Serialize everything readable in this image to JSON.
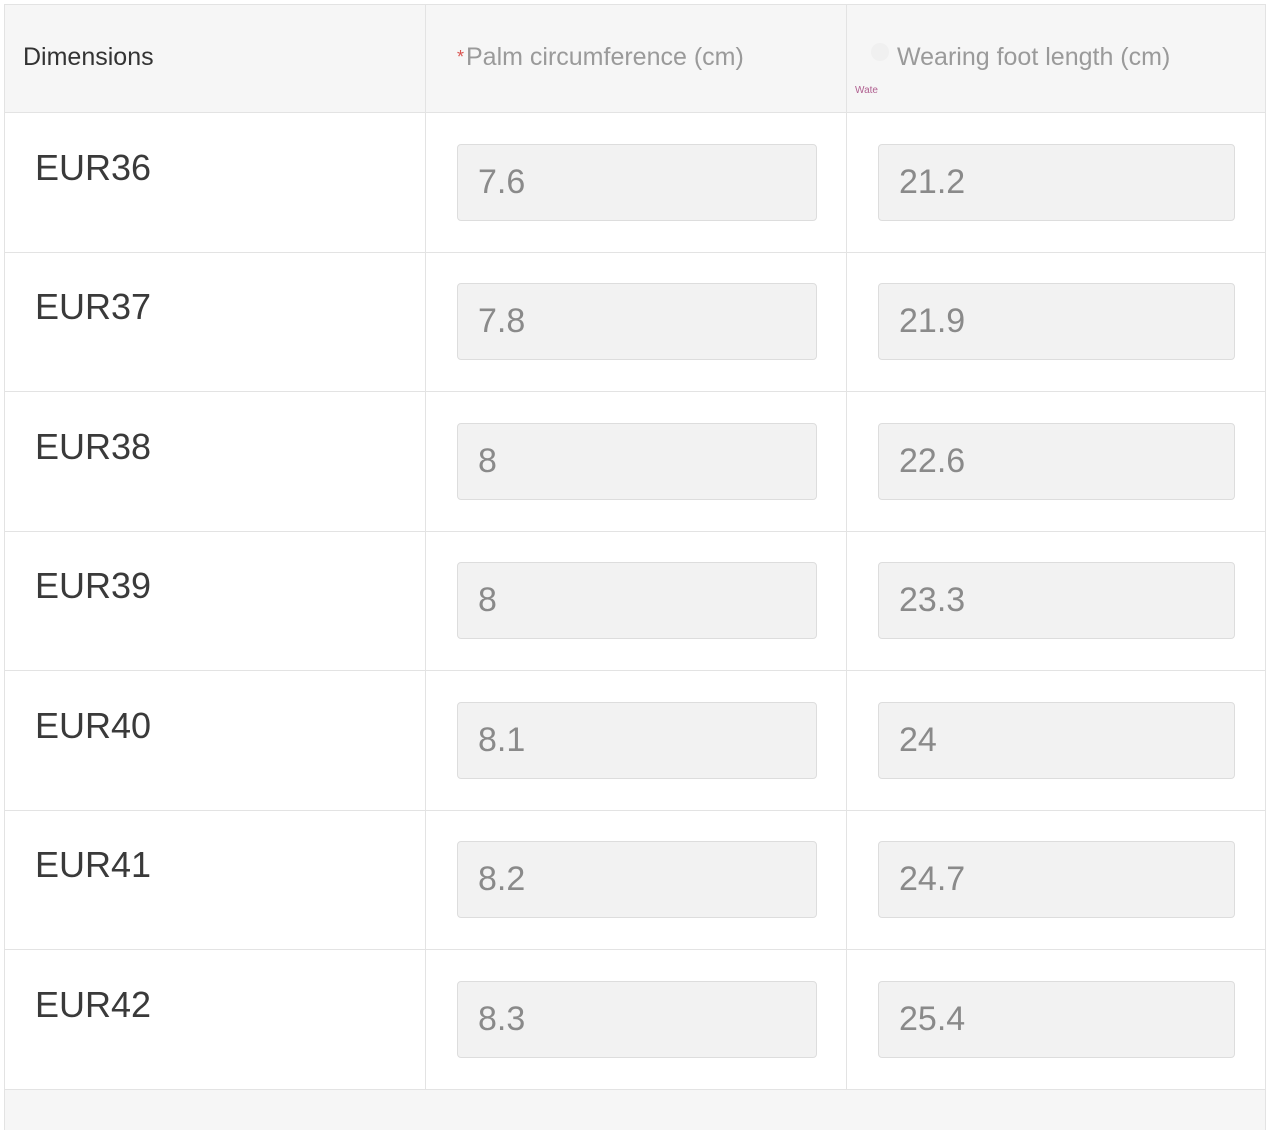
{
  "table": {
    "headers": {
      "dimensions": "Dimensions",
      "palm_required_mark": "*",
      "palm": "Palm circumference (cm)",
      "foot": "Wearing foot length (cm)",
      "foot_hint": "Wate"
    },
    "rows": [
      {
        "size": "EUR36",
        "palm": "7.6",
        "foot": "21.2"
      },
      {
        "size": "EUR37",
        "palm": "7.8",
        "foot": "21.9"
      },
      {
        "size": "EUR38",
        "palm": "8",
        "foot": "22.6"
      },
      {
        "size": "EUR39",
        "palm": "8",
        "foot": "23.3"
      },
      {
        "size": "EUR40",
        "palm": "8.1",
        "foot": "24"
      },
      {
        "size": "EUR41",
        "palm": "8.2",
        "foot": "24.7"
      },
      {
        "size": "EUR42",
        "palm": "8.3",
        "foot": "25.4"
      }
    ]
  },
  "colors": {
    "header_bg": "#f6f6f6",
    "border": "#e3e3e3",
    "input_bg": "#f2f2f2",
    "required": "#d9534f"
  }
}
